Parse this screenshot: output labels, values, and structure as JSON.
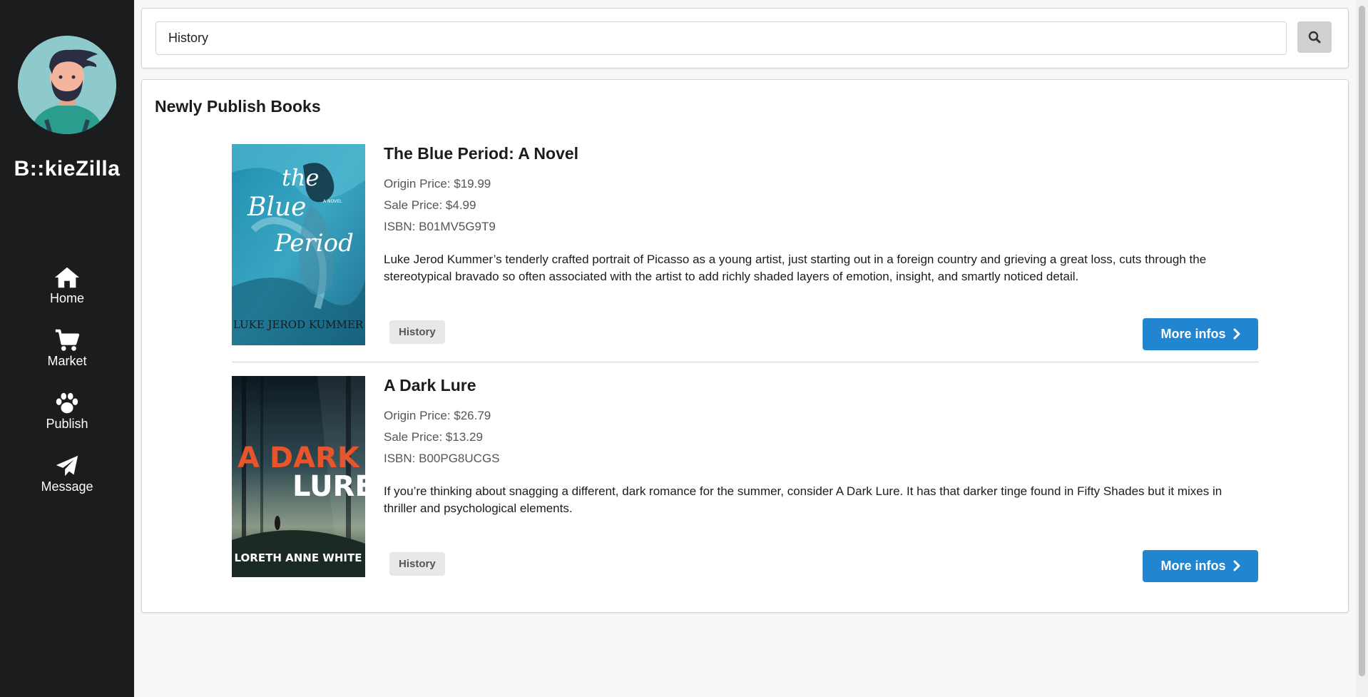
{
  "app": {
    "brand": "B::kieZilla",
    "accent_color": "#2185d0",
    "sidebar_color": "#1b1c1d"
  },
  "sidebar": {
    "items": [
      {
        "label": "Home",
        "icon": "home-icon"
      },
      {
        "label": "Market",
        "icon": "cart-icon"
      },
      {
        "label": "Publish",
        "icon": "paw-icon"
      },
      {
        "label": "Message",
        "icon": "paper-plane-icon"
      }
    ]
  },
  "search": {
    "value": "History",
    "button_icon": "search-icon"
  },
  "main": {
    "section_title": "Newly Publish Books",
    "books": [
      {
        "title": "The Blue Period: A Novel",
        "origin_price": "Origin Price: $19.99",
        "sale_price": "Sale Price: $4.99",
        "isbn": "ISBN: B01MV5G9T9",
        "description": "Luke Jerod Kummer’s tenderly crafted portrait of Picasso as a young artist, just starting out in a foreign country and grieving a great loss, cuts through the stereotypical bravado so often associated with the artist to add richly shaded layers of emotion, insight, and smartly noticed detail.",
        "tag": "History",
        "button_label": "More infos",
        "cover": {
          "title_words": [
            "the",
            "Blue",
            "Period"
          ],
          "small_text": "A NOVEL",
          "author": "LUKE JEROD KUMMER"
        }
      },
      {
        "title": "A Dark Lure",
        "origin_price": "Origin Price: $26.79",
        "sale_price": "Sale Price: $13.29",
        "isbn": "ISBN: B00PG8UCGS",
        "description": "If you’re thinking about snagging a different, dark romance for the summer, consider A Dark Lure. It has that darker tinge found in Fifty Shades but it mixes in thriller and psychological elements.",
        "tag": "History",
        "button_label": "More infos",
        "cover": {
          "title_line1": "A DARK",
          "title_line2": "LURE",
          "author": "LORETH ANNE WHITE"
        }
      }
    ]
  }
}
